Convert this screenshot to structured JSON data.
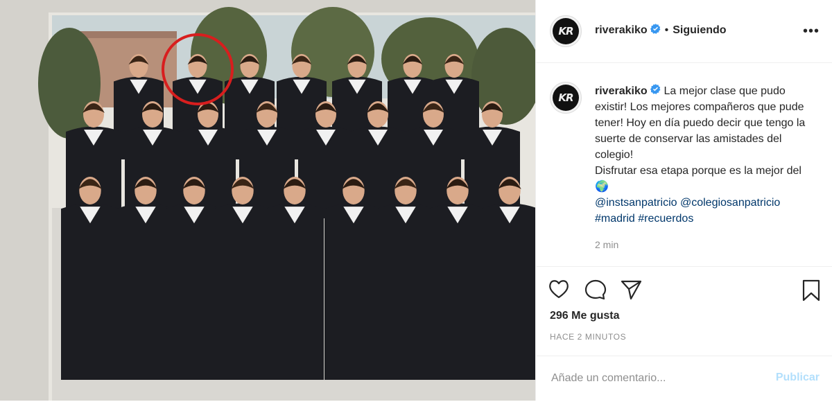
{
  "post": {
    "photo_alt": "Foto de clase escolar",
    "username": "riverakiko",
    "separator": "•",
    "follow_label": "Siguiendo",
    "more_label": "•••",
    "avatar_letters": "KR"
  },
  "caption": {
    "username": "riverakiko",
    "text": "La mejor clase que pudo existir! Los mejores compañeros que pude tener! Hoy en día puedo decir que tengo la suerte de conservar las amistades del colegio!",
    "text2": "Disfrutar esa etapa porque es la mejor del",
    "emoji": "🌍",
    "tag1": "@instsanpatricio",
    "tag2": "@colegiosanpatricio",
    "tag3": "#madrid",
    "tag4": "#recuerdos",
    "time": "2 min"
  },
  "actions": {
    "likes": "296 Me gusta",
    "ago": "HACE 2 MINUTOS"
  },
  "comment": {
    "placeholder": "Añade un comentario...",
    "publish": "Publicar"
  },
  "icons": [
    "heart-icon",
    "comment-icon",
    "share-icon",
    "bookmark-icon",
    "verified-badge-icon",
    "more-options-icon"
  ],
  "colors": {
    "verified": "#3897f0",
    "link": "#00376b",
    "publish_disabled": "#b2dffc",
    "circle_highlight": "#d81e1e"
  }
}
